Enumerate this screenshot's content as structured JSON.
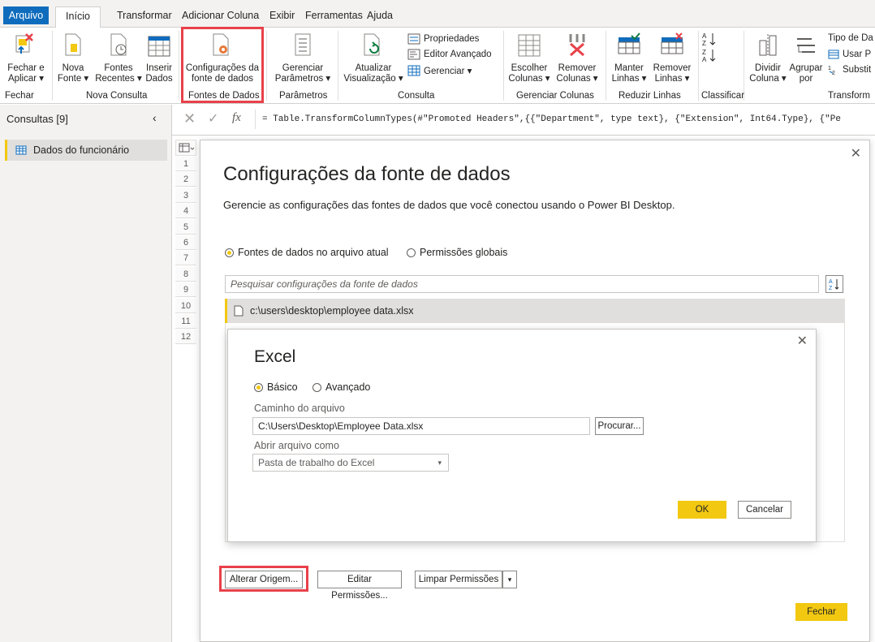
{
  "tabs": [
    "Arquivo",
    "Início",
    "Transformar",
    "Adicionar Coluna",
    "Exibir",
    "Ferramentas",
    "Ajuda"
  ],
  "ribbon": {
    "fechar_aplicar": [
      "Fechar e",
      "Aplicar ▾"
    ],
    "nova_fonte": [
      "Nova",
      "Fonte ▾"
    ],
    "fontes_recentes": [
      "Fontes",
      "Recentes ▾"
    ],
    "inserir_dados": [
      "Inserir",
      "Dados"
    ],
    "config_fonte": [
      "Configurações da",
      "fonte de dados"
    ],
    "gerenciar_params": [
      "Gerenciar",
      "Parâmetros ▾"
    ],
    "atualizar": [
      "Atualizar",
      "Visualização ▾"
    ],
    "propriedades": "Propriedades",
    "editor_avancado": "Editor Avançado",
    "gerenciar": "Gerenciar ▾",
    "escolher_colunas": [
      "Escolher",
      "Colunas ▾"
    ],
    "remover_colunas": [
      "Remover",
      "Colunas ▾"
    ],
    "manter_linhas": [
      "Manter",
      "Linhas ▾"
    ],
    "remover_linhas": [
      "Remover",
      "Linhas ▾"
    ],
    "dividir_coluna": [
      "Dividir",
      "Coluna ▾"
    ],
    "agrupar_por": [
      "Agrupar",
      "por"
    ],
    "tipo_de_dados": "Tipo de Da",
    "usar_primeira": "Usar P",
    "substituir": "Substit",
    "groups": {
      "fechar": "Fechar",
      "nova_consulta": "Nova Consulta",
      "fontes_de_dados": "Fontes de Dados",
      "parametros": "Parâmetros",
      "consulta": "Consulta",
      "gerenciar_colunas": "Gerenciar Colunas",
      "reduzir_linhas": "Reduzir Linhas",
      "classificar": "Classificar",
      "transformar": "Transform"
    }
  },
  "left_panel": {
    "title": "Consultas [9]",
    "queries": [
      "Dados do funcionário"
    ]
  },
  "formula": "= Table.TransformColumnTypes(#\"Promoted Headers\",{{\"Department\", type text}, {\"Extension\", Int64.Type}, {\"Pe",
  "row_numbers": [
    "1",
    "2",
    "3",
    "4",
    "5",
    "6",
    "7",
    "8",
    "9",
    "10",
    "11",
    "12"
  ],
  "dialog": {
    "title": "Configurações da fonte de dados",
    "subtitle": "Gerencie as configurações das fontes de dados que você conectou usando o Power BI Desktop.",
    "radio_current": "Fontes de dados no arquivo atual",
    "radio_global": "Permissões globais",
    "search_placeholder": "Pesquisar configurações da fonte de dados",
    "source_item": "c:\\users\\desktop\\employee data.xlsx",
    "btn_alterar": "Alterar Origem...",
    "btn_editar": "Editar Permissões...",
    "btn_limpar": "Limpar Permissões",
    "btn_fechar": "Fechar"
  },
  "excel_dialog": {
    "title": "Excel",
    "radio_basic": "Básico",
    "radio_advanced": "Avançado",
    "path_label": "Caminho do arquivo",
    "path_value": "C:\\Users\\Desktop\\Employee Data.xlsx",
    "btn_browse": "Procurar...",
    "open_as_label": "Abrir arquivo como",
    "open_as_value": "Pasta de trabalho do Excel",
    "btn_ok": "OK",
    "btn_cancel": "Cancelar"
  },
  "colors": {
    "accent_blue": "#0f6cbd",
    "accent_yellow": "#f2c811",
    "highlight_red": "#e8414a"
  }
}
